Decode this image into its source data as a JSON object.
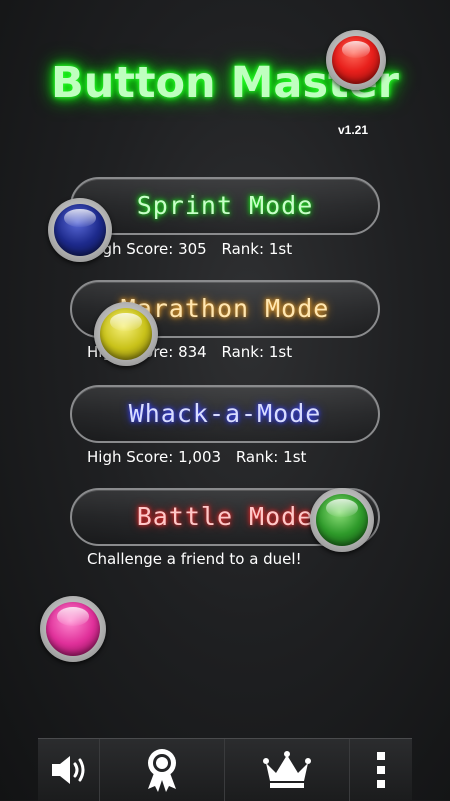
{
  "app": {
    "title": "Button Master",
    "version": "v1.21"
  },
  "modes": [
    {
      "label": "Sprint Mode",
      "high_score_label": "High Score:",
      "high_score": "305",
      "rank_label": "Rank:",
      "rank": "1st"
    },
    {
      "label": "Marathon Mode",
      "high_score_label": "High Score:",
      "high_score": "834",
      "rank_label": "Rank:",
      "rank": "1st"
    },
    {
      "label": "Whack-a-Mode",
      "high_score_label": "High Score:",
      "high_score": "1,003",
      "rank_label": "Rank:",
      "rank": "1st"
    },
    {
      "label": "Battle Mode",
      "description": "Challenge a friend to a duel!"
    }
  ],
  "orbs": {
    "red": "#e8201c",
    "blue": "#1d2a8c",
    "yellow": "#c9c21a",
    "green": "#2e9a2a",
    "pink": "#e0309a"
  },
  "toolbar": {
    "items": [
      {
        "icon": "speaker-icon"
      },
      {
        "icon": "award-ribbon-icon"
      },
      {
        "icon": "crown-icon"
      },
      {
        "icon": "more-vertical-icon"
      }
    ]
  }
}
